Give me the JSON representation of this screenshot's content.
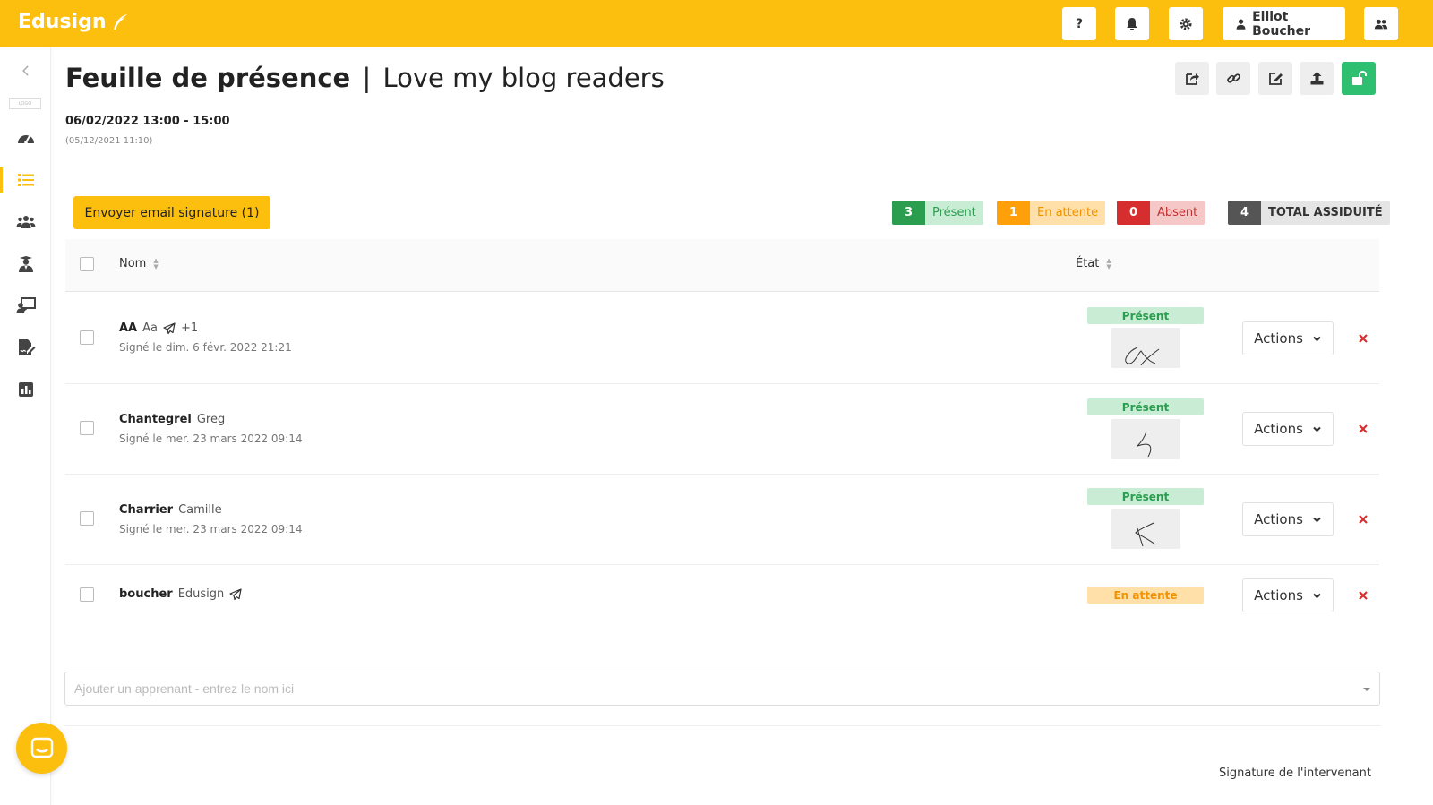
{
  "app": {
    "brand": "Edusign"
  },
  "topbar": {
    "help_label": "?",
    "user_name": "Elliot Boucher"
  },
  "sidebar": {
    "logo_text": "LOGO"
  },
  "header": {
    "title_main": "Feuille de présence",
    "title_sep": "|",
    "title_sub": "Love my blog readers",
    "date_main": "06/02/2022 13:00 - 15:00",
    "date_sub": "(05/12/2021 11:10)"
  },
  "send_button": "Envoyer email signature (1)",
  "counters": {
    "present": {
      "count": "3",
      "label": "Présent"
    },
    "waiting": {
      "count": "1",
      "label": "En attente"
    },
    "absent": {
      "count": "0",
      "label": "Absent"
    },
    "total": {
      "count": "4",
      "label": "TOTAL ASSIDUITÉ"
    }
  },
  "table": {
    "col_name": "Nom",
    "col_state": "État",
    "rows": [
      {
        "last": "AA",
        "first": "Aa",
        "extra": "+1",
        "signed": "Signé le dim. 6 févr. 2022 21:21",
        "state": "Présent",
        "actions": "Actions"
      },
      {
        "last": "Chantegrel",
        "first": "Greg",
        "extra": "",
        "signed": "Signé le mer. 23 mars 2022 09:14",
        "state": "Présent",
        "actions": "Actions"
      },
      {
        "last": "Charrier",
        "first": "Camille",
        "extra": "",
        "signed": "Signé le mer. 23 mars 2022 09:14",
        "state": "Présent",
        "actions": "Actions"
      },
      {
        "last": "boucher",
        "first": "Edusign",
        "extra": "",
        "signed": "",
        "state": "En attente",
        "actions": "Actions"
      }
    ]
  },
  "add_learner": {
    "placeholder": "Ajouter un apprenant - entrez le nom ici",
    "value": ""
  },
  "footer": {
    "signature_label": "Signature de l'intervenant"
  },
  "colors": {
    "brand": "#fdbf0e",
    "present": "#2a9d4f",
    "waiting": "#ff9f0a",
    "absent": "#d62e2e",
    "unlock": "#2fbf71"
  }
}
